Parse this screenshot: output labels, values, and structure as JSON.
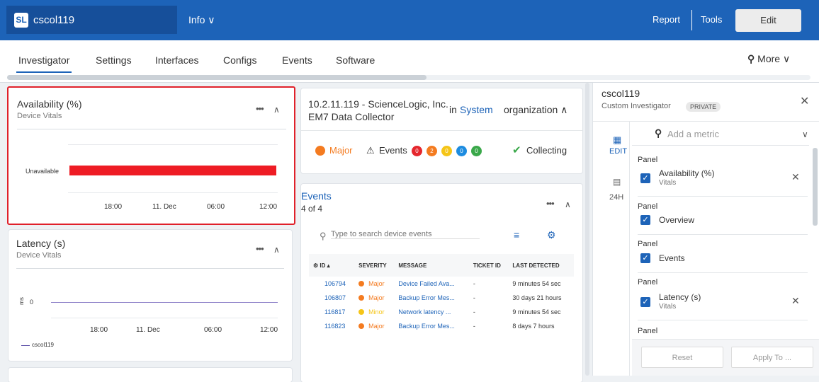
{
  "topbar": {
    "logo": "SL",
    "device": "cscol119",
    "info_menu": "Info ∨",
    "report": "Report",
    "tools": "Tools",
    "edit": "Edit"
  },
  "tabs": [
    "Investigator",
    "Settings",
    "Interfaces",
    "Configs",
    "Events",
    "Software"
  ],
  "more": "More ∨",
  "availability": {
    "title": "Availability (%)",
    "subtitle": "Device Vitals",
    "row_label": "Unavailable",
    "x_ticks": [
      "18:00",
      "11. Dec",
      "06:00",
      "12:00"
    ],
    "bar_color": "#ee1c24"
  },
  "latency": {
    "title": "Latency (s)",
    "subtitle": "Device Vitals",
    "y_label": "ms",
    "y_tick": "0",
    "x_ticks": [
      "18:00",
      "11. Dec",
      "06:00",
      "12:00"
    ],
    "legend": "cscol119"
  },
  "device_card": {
    "title_line1": "10.2.11.119 - ScienceLogic, Inc.",
    "title_line2": "EM7 Data Collector",
    "in_text": "in",
    "org_link": "System",
    "org_text": "organization ∧",
    "severity": "Major",
    "events_label": "Events",
    "badges": [
      {
        "value": "0",
        "color": "#e5272e"
      },
      {
        "value": "2",
        "color": "#f47b20"
      },
      {
        "value": "0",
        "color": "#f5c518"
      },
      {
        "value": "0",
        "color": "#1d8ce0"
      },
      {
        "value": "0",
        "color": "#3aa84a"
      }
    ],
    "collecting": "Collecting"
  },
  "events": {
    "title": "Events",
    "count": "4 of 4",
    "search_placeholder": "Type to search device events",
    "columns": [
      "ID ▴",
      "SEVERITY",
      "MESSAGE",
      "TICKET ID",
      "LAST DETECTED"
    ],
    "rows": [
      {
        "id": "106794",
        "severity": "Major",
        "sev_color": "#f47b20",
        "message": "Device Failed Ava...",
        "ticket": "-",
        "last": "9 minutes 54 sec"
      },
      {
        "id": "106807",
        "severity": "Major",
        "sev_color": "#f47b20",
        "message": "Backup Error Mes...",
        "ticket": "-",
        "last": "30 days 21 hours"
      },
      {
        "id": "116817",
        "severity": "Minor",
        "sev_color": "#f5c518",
        "message": "Network latency ...",
        "ticket": "-",
        "last": "9 minutes 54 sec"
      },
      {
        "id": "116823",
        "severity": "Major",
        "sev_color": "#f47b20",
        "message": "Backup Error Mes...",
        "ticket": "-",
        "last": "8 days 7 hours"
      }
    ]
  },
  "right_panel": {
    "device": "cscol119",
    "subtitle": "Custom Investigator",
    "badge": "PRIVATE",
    "edit_label": "EDIT",
    "range_label": "24H",
    "add_metric_placeholder": "Add a metric",
    "panel_word": "Panel",
    "items": [
      {
        "label": "Availability (%)",
        "sub": "Vitals"
      },
      {
        "label": "Overview",
        "sub": ""
      },
      {
        "label": "Events",
        "sub": ""
      },
      {
        "label": "Latency (s)",
        "sub": "Vitals"
      }
    ],
    "reset": "Reset",
    "apply": "Apply To ..."
  }
}
